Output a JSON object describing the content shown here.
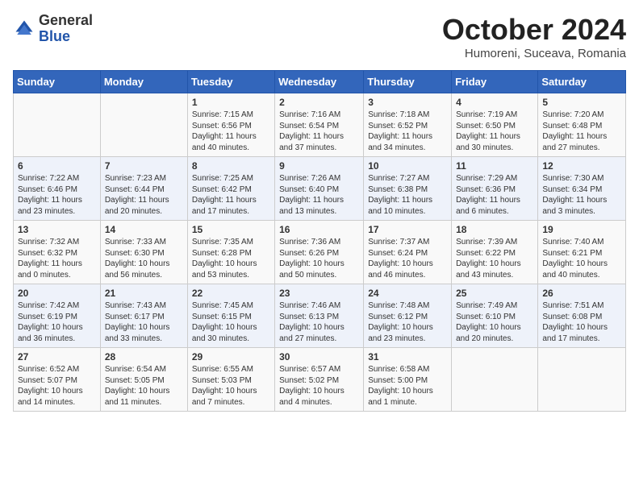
{
  "header": {
    "logo_general": "General",
    "logo_blue": "Blue",
    "month": "October 2024",
    "location": "Humoreni, Suceava, Romania"
  },
  "days_of_week": [
    "Sunday",
    "Monday",
    "Tuesday",
    "Wednesday",
    "Thursday",
    "Friday",
    "Saturday"
  ],
  "weeks": [
    [
      {
        "day": "",
        "content": ""
      },
      {
        "day": "",
        "content": ""
      },
      {
        "day": "1",
        "content": "Sunrise: 7:15 AM\nSunset: 6:56 PM\nDaylight: 11 hours and 40 minutes."
      },
      {
        "day": "2",
        "content": "Sunrise: 7:16 AM\nSunset: 6:54 PM\nDaylight: 11 hours and 37 minutes."
      },
      {
        "day": "3",
        "content": "Sunrise: 7:18 AM\nSunset: 6:52 PM\nDaylight: 11 hours and 34 minutes."
      },
      {
        "day": "4",
        "content": "Sunrise: 7:19 AM\nSunset: 6:50 PM\nDaylight: 11 hours and 30 minutes."
      },
      {
        "day": "5",
        "content": "Sunrise: 7:20 AM\nSunset: 6:48 PM\nDaylight: 11 hours and 27 minutes."
      }
    ],
    [
      {
        "day": "6",
        "content": "Sunrise: 7:22 AM\nSunset: 6:46 PM\nDaylight: 11 hours and 23 minutes."
      },
      {
        "day": "7",
        "content": "Sunrise: 7:23 AM\nSunset: 6:44 PM\nDaylight: 11 hours and 20 minutes."
      },
      {
        "day": "8",
        "content": "Sunrise: 7:25 AM\nSunset: 6:42 PM\nDaylight: 11 hours and 17 minutes."
      },
      {
        "day": "9",
        "content": "Sunrise: 7:26 AM\nSunset: 6:40 PM\nDaylight: 11 hours and 13 minutes."
      },
      {
        "day": "10",
        "content": "Sunrise: 7:27 AM\nSunset: 6:38 PM\nDaylight: 11 hours and 10 minutes."
      },
      {
        "day": "11",
        "content": "Sunrise: 7:29 AM\nSunset: 6:36 PM\nDaylight: 11 hours and 6 minutes."
      },
      {
        "day": "12",
        "content": "Sunrise: 7:30 AM\nSunset: 6:34 PM\nDaylight: 11 hours and 3 minutes."
      }
    ],
    [
      {
        "day": "13",
        "content": "Sunrise: 7:32 AM\nSunset: 6:32 PM\nDaylight: 11 hours and 0 minutes."
      },
      {
        "day": "14",
        "content": "Sunrise: 7:33 AM\nSunset: 6:30 PM\nDaylight: 10 hours and 56 minutes."
      },
      {
        "day": "15",
        "content": "Sunrise: 7:35 AM\nSunset: 6:28 PM\nDaylight: 10 hours and 53 minutes."
      },
      {
        "day": "16",
        "content": "Sunrise: 7:36 AM\nSunset: 6:26 PM\nDaylight: 10 hours and 50 minutes."
      },
      {
        "day": "17",
        "content": "Sunrise: 7:37 AM\nSunset: 6:24 PM\nDaylight: 10 hours and 46 minutes."
      },
      {
        "day": "18",
        "content": "Sunrise: 7:39 AM\nSunset: 6:22 PM\nDaylight: 10 hours and 43 minutes."
      },
      {
        "day": "19",
        "content": "Sunrise: 7:40 AM\nSunset: 6:21 PM\nDaylight: 10 hours and 40 minutes."
      }
    ],
    [
      {
        "day": "20",
        "content": "Sunrise: 7:42 AM\nSunset: 6:19 PM\nDaylight: 10 hours and 36 minutes."
      },
      {
        "day": "21",
        "content": "Sunrise: 7:43 AM\nSunset: 6:17 PM\nDaylight: 10 hours and 33 minutes."
      },
      {
        "day": "22",
        "content": "Sunrise: 7:45 AM\nSunset: 6:15 PM\nDaylight: 10 hours and 30 minutes."
      },
      {
        "day": "23",
        "content": "Sunrise: 7:46 AM\nSunset: 6:13 PM\nDaylight: 10 hours and 27 minutes."
      },
      {
        "day": "24",
        "content": "Sunrise: 7:48 AM\nSunset: 6:12 PM\nDaylight: 10 hours and 23 minutes."
      },
      {
        "day": "25",
        "content": "Sunrise: 7:49 AM\nSunset: 6:10 PM\nDaylight: 10 hours and 20 minutes."
      },
      {
        "day": "26",
        "content": "Sunrise: 7:51 AM\nSunset: 6:08 PM\nDaylight: 10 hours and 17 minutes."
      }
    ],
    [
      {
        "day": "27",
        "content": "Sunrise: 6:52 AM\nSunset: 5:07 PM\nDaylight: 10 hours and 14 minutes."
      },
      {
        "day": "28",
        "content": "Sunrise: 6:54 AM\nSunset: 5:05 PM\nDaylight: 10 hours and 11 minutes."
      },
      {
        "day": "29",
        "content": "Sunrise: 6:55 AM\nSunset: 5:03 PM\nDaylight: 10 hours and 7 minutes."
      },
      {
        "day": "30",
        "content": "Sunrise: 6:57 AM\nSunset: 5:02 PM\nDaylight: 10 hours and 4 minutes."
      },
      {
        "day": "31",
        "content": "Sunrise: 6:58 AM\nSunset: 5:00 PM\nDaylight: 10 hours and 1 minute."
      },
      {
        "day": "",
        "content": ""
      },
      {
        "day": "",
        "content": ""
      }
    ]
  ]
}
